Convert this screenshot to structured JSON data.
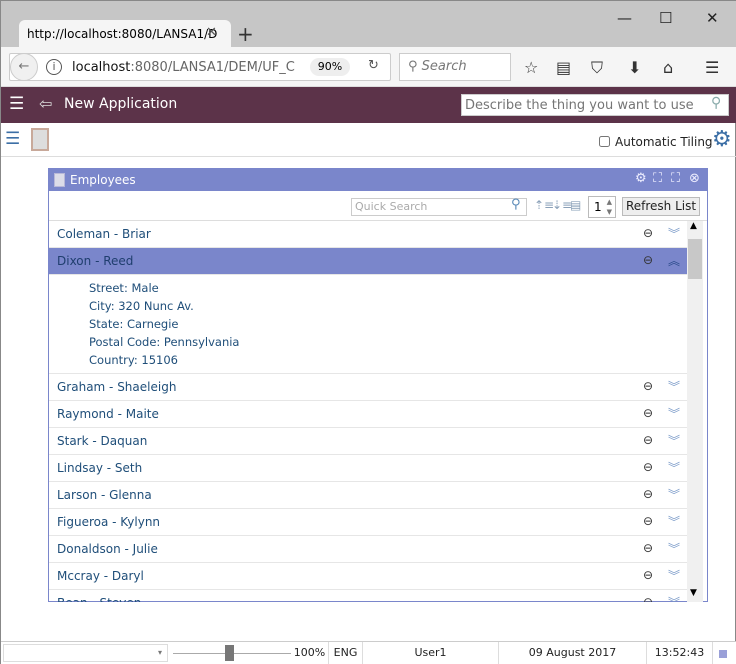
{
  "browser": {
    "tab_title": "http://localhost:8080/LANSA1/D",
    "url_host": "localhost",
    "url_rest": ":8080/LANSA1/DEM/UF_C",
    "zoom": "90%",
    "search_placeholder": "Search"
  },
  "app": {
    "title": "New Application",
    "search_placeholder": "Describe the thing you want to use",
    "auto_tiling_label": "Automatic Tiling"
  },
  "panel": {
    "title": "Employees",
    "quick_search_placeholder": "Quick Search",
    "page_value": "1",
    "refresh_label": "Refresh List",
    "rows_before": [
      {
        "name": "Coleman - Briar"
      }
    ],
    "selected": {
      "name": "Dixon - Reed",
      "details": [
        "Street: Male",
        "City: 320 Nunc Av.",
        "State: Carnegie",
        "Postal Code: Pennsylvania",
        "Country: 15106"
      ]
    },
    "rows_after": [
      {
        "name": "Graham - Shaeleigh"
      },
      {
        "name": "Raymond - Maite"
      },
      {
        "name": "Stark - Daquan"
      },
      {
        "name": "Lindsay - Seth"
      },
      {
        "name": "Larson - Glenna"
      },
      {
        "name": "Figueroa - Kylynn"
      },
      {
        "name": "Donaldson - Julie"
      },
      {
        "name": "Mccray - Daryl"
      },
      {
        "name": "Bean - Steven"
      }
    ]
  },
  "status": {
    "zoom": "100%",
    "language": "ENG",
    "user": "User1",
    "date": "09 August 2017",
    "time": "13:52:43"
  }
}
